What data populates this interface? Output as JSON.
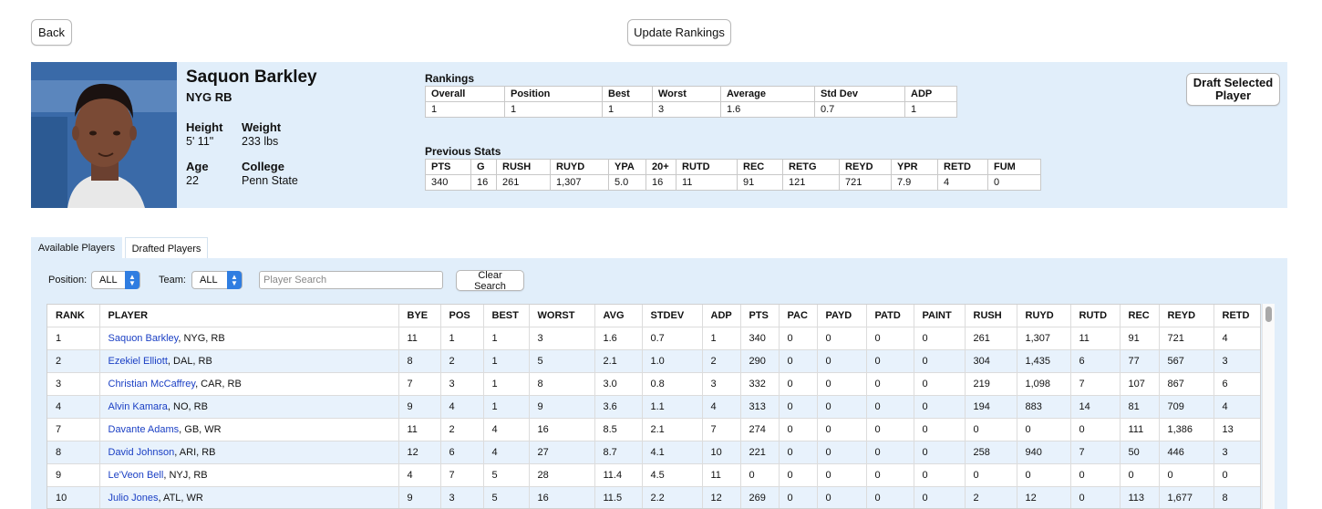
{
  "top": {
    "back_label": "Back",
    "update_label": "Update Rankings"
  },
  "player": {
    "name": "Saquon Barkley",
    "team_pos": "NYG RB",
    "height_label": "Height",
    "height": "5' 11\"",
    "weight_label": "Weight",
    "weight": "233 lbs",
    "age_label": "Age",
    "age": "22",
    "college_label": "College",
    "college": "Penn State",
    "draft_label": "Draft Selected Player"
  },
  "rankings": {
    "title": "Rankings",
    "headers": [
      "Overall",
      "Position",
      "Best",
      "Worst",
      "Average",
      "Std Dev",
      "ADP"
    ],
    "values": [
      "1",
      "1",
      "1",
      "3",
      "1.6",
      "0.7",
      "1"
    ]
  },
  "prev_stats": {
    "title": "Previous Stats",
    "headers": [
      "PTS",
      "G",
      "RUSH",
      "RUYD",
      "YPA",
      "20+",
      "RUTD",
      "REC",
      "RETG",
      "REYD",
      "YPR",
      "RETD",
      "FUM"
    ],
    "values": [
      "340",
      "16",
      "261",
      "1,307",
      "5.0",
      "16",
      "11",
      "91",
      "121",
      "721",
      "7.9",
      "4",
      "0"
    ]
  },
  "tabs": {
    "available": "Available Players",
    "drafted": "Drafted Players"
  },
  "filters": {
    "position_label": "Position:",
    "position_value": "ALL",
    "team_label": "Team:",
    "team_value": "ALL",
    "search_placeholder": "Player Search",
    "clear_label": "Clear Search"
  },
  "grid": {
    "headers": [
      "RANK",
      "PLAYER",
      "BYE",
      "POS",
      "BEST",
      "WORST",
      "AVG",
      "STDEV",
      "ADP",
      "PTS",
      "PAC",
      "PAYD",
      "PATD",
      "PAINT",
      "RUSH",
      "RUYD",
      "RUTD",
      "REC",
      "REYD",
      "RETD"
    ],
    "rows": [
      {
        "rank": "1",
        "name": "Saquon Barkley",
        "info": ", NYG, RB",
        "cells": [
          "11",
          "1",
          "1",
          "3",
          "1.6",
          "0.7",
          "1",
          "340",
          "0",
          "0",
          "0",
          "0",
          "261",
          "1,307",
          "11",
          "91",
          "721",
          "4"
        ]
      },
      {
        "rank": "2",
        "name": "Ezekiel Elliott",
        "info": ", DAL, RB",
        "cells": [
          "8",
          "2",
          "1",
          "5",
          "2.1",
          "1.0",
          "2",
          "290",
          "0",
          "0",
          "0",
          "0",
          "304",
          "1,435",
          "6",
          "77",
          "567",
          "3"
        ]
      },
      {
        "rank": "3",
        "name": "Christian McCaffrey",
        "info": ", CAR, RB",
        "cells": [
          "7",
          "3",
          "1",
          "8",
          "3.0",
          "0.8",
          "3",
          "332",
          "0",
          "0",
          "0",
          "0",
          "219",
          "1,098",
          "7",
          "107",
          "867",
          "6"
        ]
      },
      {
        "rank": "4",
        "name": "Alvin Kamara",
        "info": ", NO, RB",
        "cells": [
          "9",
          "4",
          "1",
          "9",
          "3.6",
          "1.1",
          "4",
          "313",
          "0",
          "0",
          "0",
          "0",
          "194",
          "883",
          "14",
          "81",
          "709",
          "4"
        ]
      },
      {
        "rank": "7",
        "name": "Davante Adams",
        "info": ", GB, WR",
        "cells": [
          "11",
          "2",
          "4",
          "16",
          "8.5",
          "2.1",
          "7",
          "274",
          "0",
          "0",
          "0",
          "0",
          "0",
          "0",
          "0",
          "111",
          "1,386",
          "13"
        ]
      },
      {
        "rank": "8",
        "name": "David Johnson",
        "info": ", ARI, RB",
        "cells": [
          "12",
          "6",
          "4",
          "27",
          "8.7",
          "4.1",
          "10",
          "221",
          "0",
          "0",
          "0",
          "0",
          "258",
          "940",
          "7",
          "50",
          "446",
          "3"
        ]
      },
      {
        "rank": "9",
        "name": "Le'Veon Bell",
        "info": ", NYJ, RB",
        "cells": [
          "4",
          "7",
          "5",
          "28",
          "11.4",
          "4.5",
          "11",
          "0",
          "0",
          "0",
          "0",
          "0",
          "0",
          "0",
          "0",
          "0",
          "0",
          "0"
        ]
      },
      {
        "rank": "10",
        "name": "Julio Jones",
        "info": ", ATL, WR",
        "cells": [
          "9",
          "3",
          "5",
          "16",
          "11.5",
          "2.2",
          "12",
          "269",
          "0",
          "0",
          "0",
          "0",
          "2",
          "12",
          "0",
          "113",
          "1,677",
          "8"
        ]
      }
    ]
  }
}
